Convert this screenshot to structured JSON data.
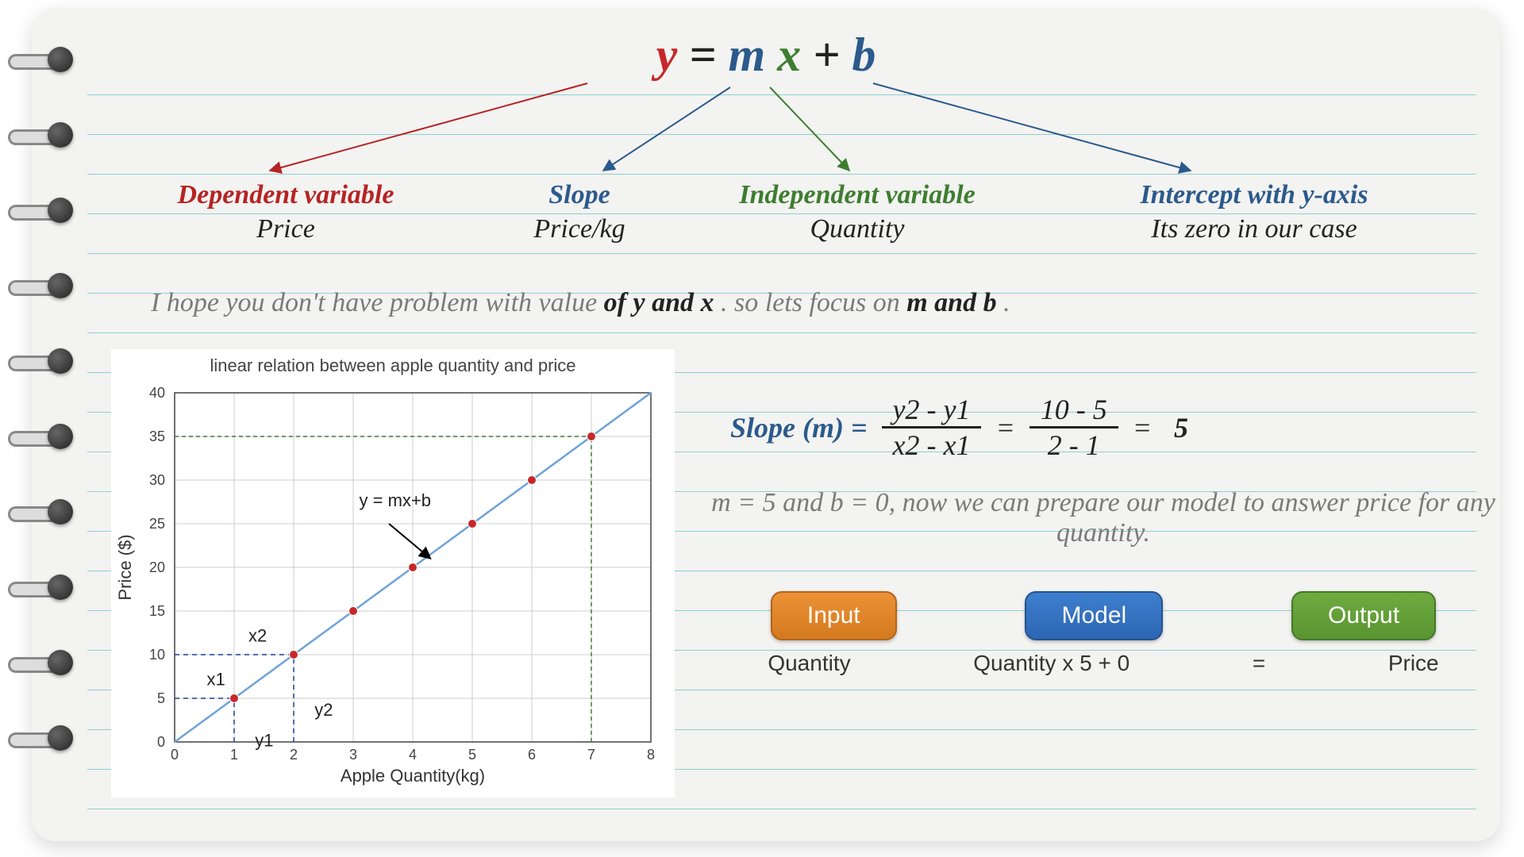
{
  "equation": {
    "y": "y",
    "eq": " = ",
    "m": "m",
    "x": "x",
    "plus": " + ",
    "b": "b"
  },
  "defs": {
    "y": {
      "t1": "Dependent variable",
      "t2": "Price"
    },
    "m": {
      "t1": "Slope",
      "t2": "Price/kg"
    },
    "x": {
      "t1": "Independent variable",
      "t2": "Quantity"
    },
    "b": {
      "t1": "Intercept with y-axis",
      "t2": "Its zero in our case"
    }
  },
  "note1_pre": "I hope you don't have problem with value ",
  "note1_b1": "of y and x",
  "note1_mid": ". so lets focus on ",
  "note1_b2": "m and b",
  "note1_end": ".",
  "slope": {
    "label": "Slope (m) = ",
    "num1": "y2 - y1",
    "den1": "x2 - x1",
    "eq1": "=",
    "num2": "10 - 5",
    "den2": "2 - 1",
    "eq2": "=",
    "result": "5"
  },
  "note2": "m = 5 and b = 0, now we can prepare our model to answer price for any quantity.",
  "boxes": {
    "input": "Input",
    "model": "Model",
    "output": "Output"
  },
  "boxsub": {
    "input": "Quantity",
    "model": "Quantity x 5 + 0",
    "eq": "=",
    "output": "Price"
  },
  "chart": {
    "title": "linear relation between apple quantity and price",
    "xlabel": "Apple Quantity(kg)",
    "ylabel": "Price ($)",
    "line_label": "y = mx+b",
    "ann": {
      "x1": "x1",
      "x2": "x2",
      "y1": "y1",
      "y2": "y2"
    }
  },
  "chart_data": {
    "type": "line",
    "title": "linear relation between apple quantity and price",
    "xlabel": "Apple Quantity(kg)",
    "ylabel": "Price ($)",
    "categories": [
      1,
      2,
      3,
      4,
      5,
      6,
      7
    ],
    "values": [
      5,
      10,
      15,
      20,
      25,
      30,
      35
    ],
    "xlim": [
      0,
      8
    ],
    "ylim": [
      0,
      40
    ],
    "xticks": [
      0,
      1,
      2,
      3,
      4,
      5,
      6,
      7,
      8
    ],
    "yticks": [
      0,
      5,
      10,
      15,
      20,
      25,
      30,
      35,
      40
    ],
    "example_points": {
      "p1": {
        "x": 1,
        "y": 5,
        "label_x": "x1",
        "label_y": "y1"
      },
      "p2": {
        "x": 2,
        "y": 10,
        "label_x": "x2",
        "label_y": "y2"
      }
    },
    "highlight_dashed": {
      "x": 7,
      "y": 35
    },
    "slope": 5,
    "intercept": 0
  }
}
